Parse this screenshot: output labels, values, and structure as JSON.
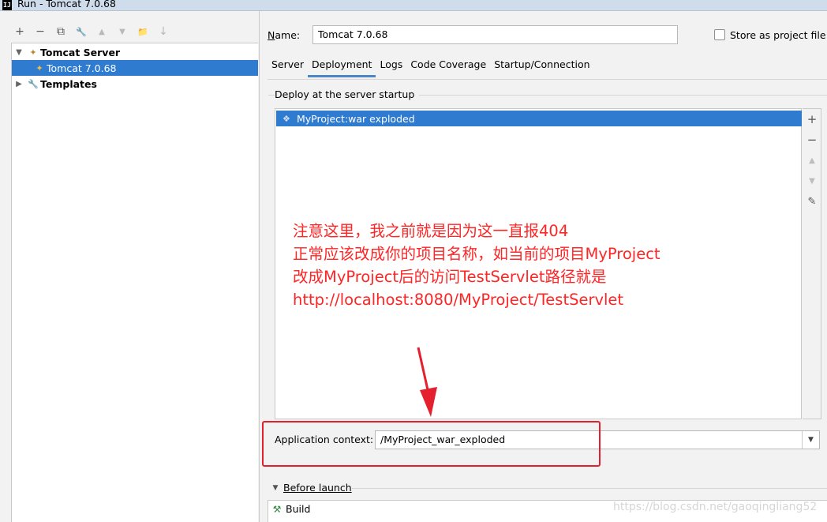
{
  "window": {
    "title": "Run - Tomcat 7.0.68",
    "app_icon": "IJ"
  },
  "toolbar": {
    "buttons": [
      {
        "name": "add-icon",
        "glyph": "+"
      },
      {
        "name": "remove-icon",
        "glyph": "−"
      },
      {
        "name": "copy-icon",
        "glyph": "⧉"
      },
      {
        "name": "wrench-icon",
        "glyph": "🔧"
      },
      {
        "name": "move-up-icon",
        "glyph": "▲"
      },
      {
        "name": "move-down-icon",
        "glyph": "▼"
      },
      {
        "name": "folder-add-icon",
        "glyph": "📁"
      },
      {
        "name": "sort-icon",
        "glyph": "↓"
      }
    ]
  },
  "tree": {
    "items": [
      {
        "label": "Tomcat Server",
        "expanded": true,
        "bold": true
      },
      {
        "label": "Tomcat 7.0.68",
        "selected": true
      },
      {
        "label": "Templates",
        "expanded": false,
        "bold": true
      }
    ]
  },
  "config": {
    "name_label_prefix": "N",
    "name_label_rest": "ame:",
    "name_value": "Tomcat 7.0.68",
    "store_label": "Store as project file",
    "store_checked": false
  },
  "tabs": [
    {
      "label": "Server",
      "active": false
    },
    {
      "label": "Deployment",
      "active": true
    },
    {
      "label": "Logs",
      "active": false
    },
    {
      "label": "Code Coverage",
      "active": false
    },
    {
      "label": "Startup/Connection",
      "active": false
    }
  ],
  "deployment": {
    "section_title": "Deploy at the server startup",
    "items": [
      {
        "label": "MyProject:war exploded",
        "selected": true
      }
    ],
    "side_buttons": [
      {
        "name": "add-icon",
        "glyph": "+",
        "enabled": true
      },
      {
        "name": "remove-icon",
        "glyph": "−",
        "enabled": true
      },
      {
        "name": "move-up-icon",
        "glyph": "▲",
        "enabled": false
      },
      {
        "name": "move-down-icon",
        "glyph": "▼",
        "enabled": false
      },
      {
        "name": "edit-icon",
        "glyph": "✎",
        "enabled": true
      }
    ]
  },
  "annotation": {
    "lines": [
      "注意这里，我之前就是因为这一直报404",
      "正常应该改成你的项目名称，如当前的项目MyProject",
      "改成MyProject后的访问TestServlet路径就是",
      "http://localhost:8080/MyProject/TestServlet"
    ],
    "color": "#ff2525"
  },
  "application_context": {
    "label": "Application context:",
    "value": "/MyProject_war_exploded"
  },
  "before_launch": {
    "title": "Before launch",
    "items": [
      {
        "label": "Build"
      }
    ]
  },
  "watermark": "https://blog.csdn.net/gaoqingliang52",
  "colors": {
    "selection": "#2f7bd0",
    "highlight_box": "#e5202e",
    "tab_underline": "#4a87c8"
  }
}
